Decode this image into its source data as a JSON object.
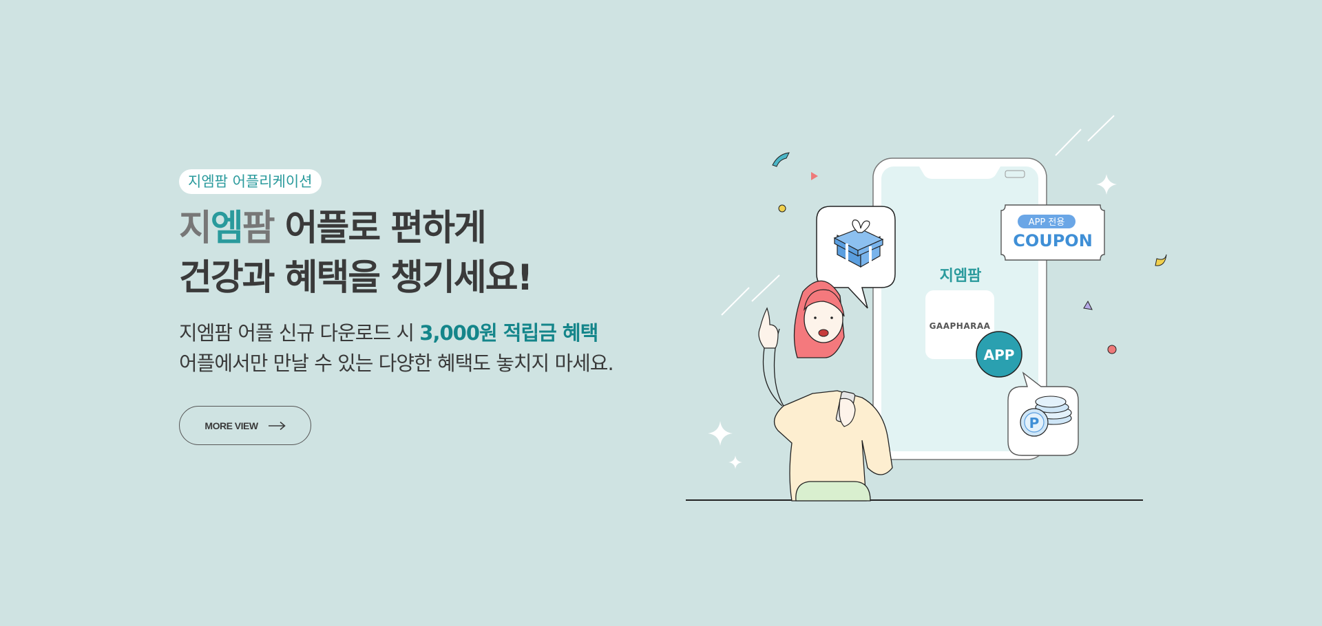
{
  "banner": {
    "tag": "지엠팜 어플리케이션",
    "headline": {
      "brand_part1": "지",
      "brand_part2": "엠",
      "brand_part3": "팜",
      "line1_rest": " 어플로 편하게",
      "line2": "건강과 혜택을 챙기세요!"
    },
    "description": {
      "line1_prefix": "지엠팜 어플 신규 다운로드 시 ",
      "line1_highlight": "3,000원 적립금 혜택",
      "line2": "어플에서만 만날 수 있는 다양한 혜택도 놓치지 마세요."
    },
    "button_label": "MORE VIEW"
  },
  "illustration": {
    "phone_brand": "지엠팜",
    "logo_text": "GAAPHARAA",
    "app_badge": "APP",
    "coupon_top": "APP 전용",
    "coupon_main": "COUPON",
    "point_symbol": "P"
  },
  "colors": {
    "background": "#cfe3e2",
    "accent": "#2a9a9c",
    "highlight": "#14858a",
    "text": "#3a3a3a"
  }
}
